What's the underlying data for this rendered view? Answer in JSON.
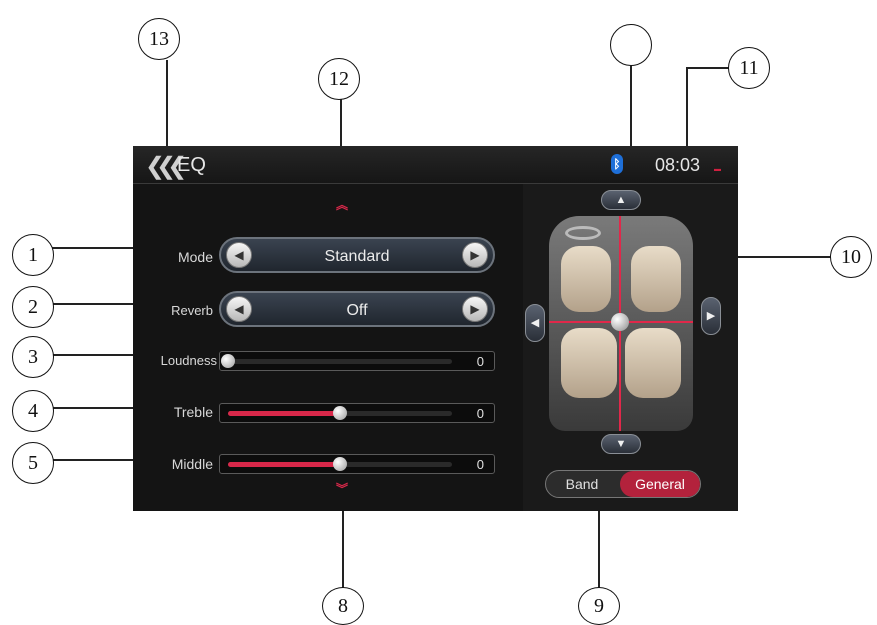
{
  "header": {
    "title": "EQ",
    "time": "08:03"
  },
  "controls": {
    "mode": {
      "label": "Mode",
      "value": "Standard"
    },
    "reverb": {
      "label": "Reverb",
      "value": "Off"
    },
    "loudness": {
      "label": "Loudness",
      "value": "0",
      "level": 0
    },
    "treble": {
      "label": "Treble",
      "value": "0",
      "level": 0.5
    },
    "middle": {
      "label": "Middle",
      "value": "0",
      "level": 0.5
    }
  },
  "toggle": {
    "band": "Band",
    "general": "General",
    "selected": "General"
  },
  "callouts": {
    "c1": "1",
    "c2": "2",
    "c3": "3",
    "c4": "4",
    "c5": "5",
    "c8": "8",
    "c9": "9",
    "c10": "10",
    "c11": "11",
    "c12": "12",
    "c13": "13",
    "c_blank": ""
  },
  "colors": {
    "accent": "#d8284a",
    "bluetooth": "#1e6fd8",
    "screen_bg": "#141414"
  },
  "icons": {
    "back": "back-double-chevron-icon",
    "bluetooth": "bluetooth-icon",
    "up": "up-arrow-icon",
    "down": "down-arrow-icon",
    "left": "left-arrow-icon",
    "right": "right-arrow-icon"
  }
}
